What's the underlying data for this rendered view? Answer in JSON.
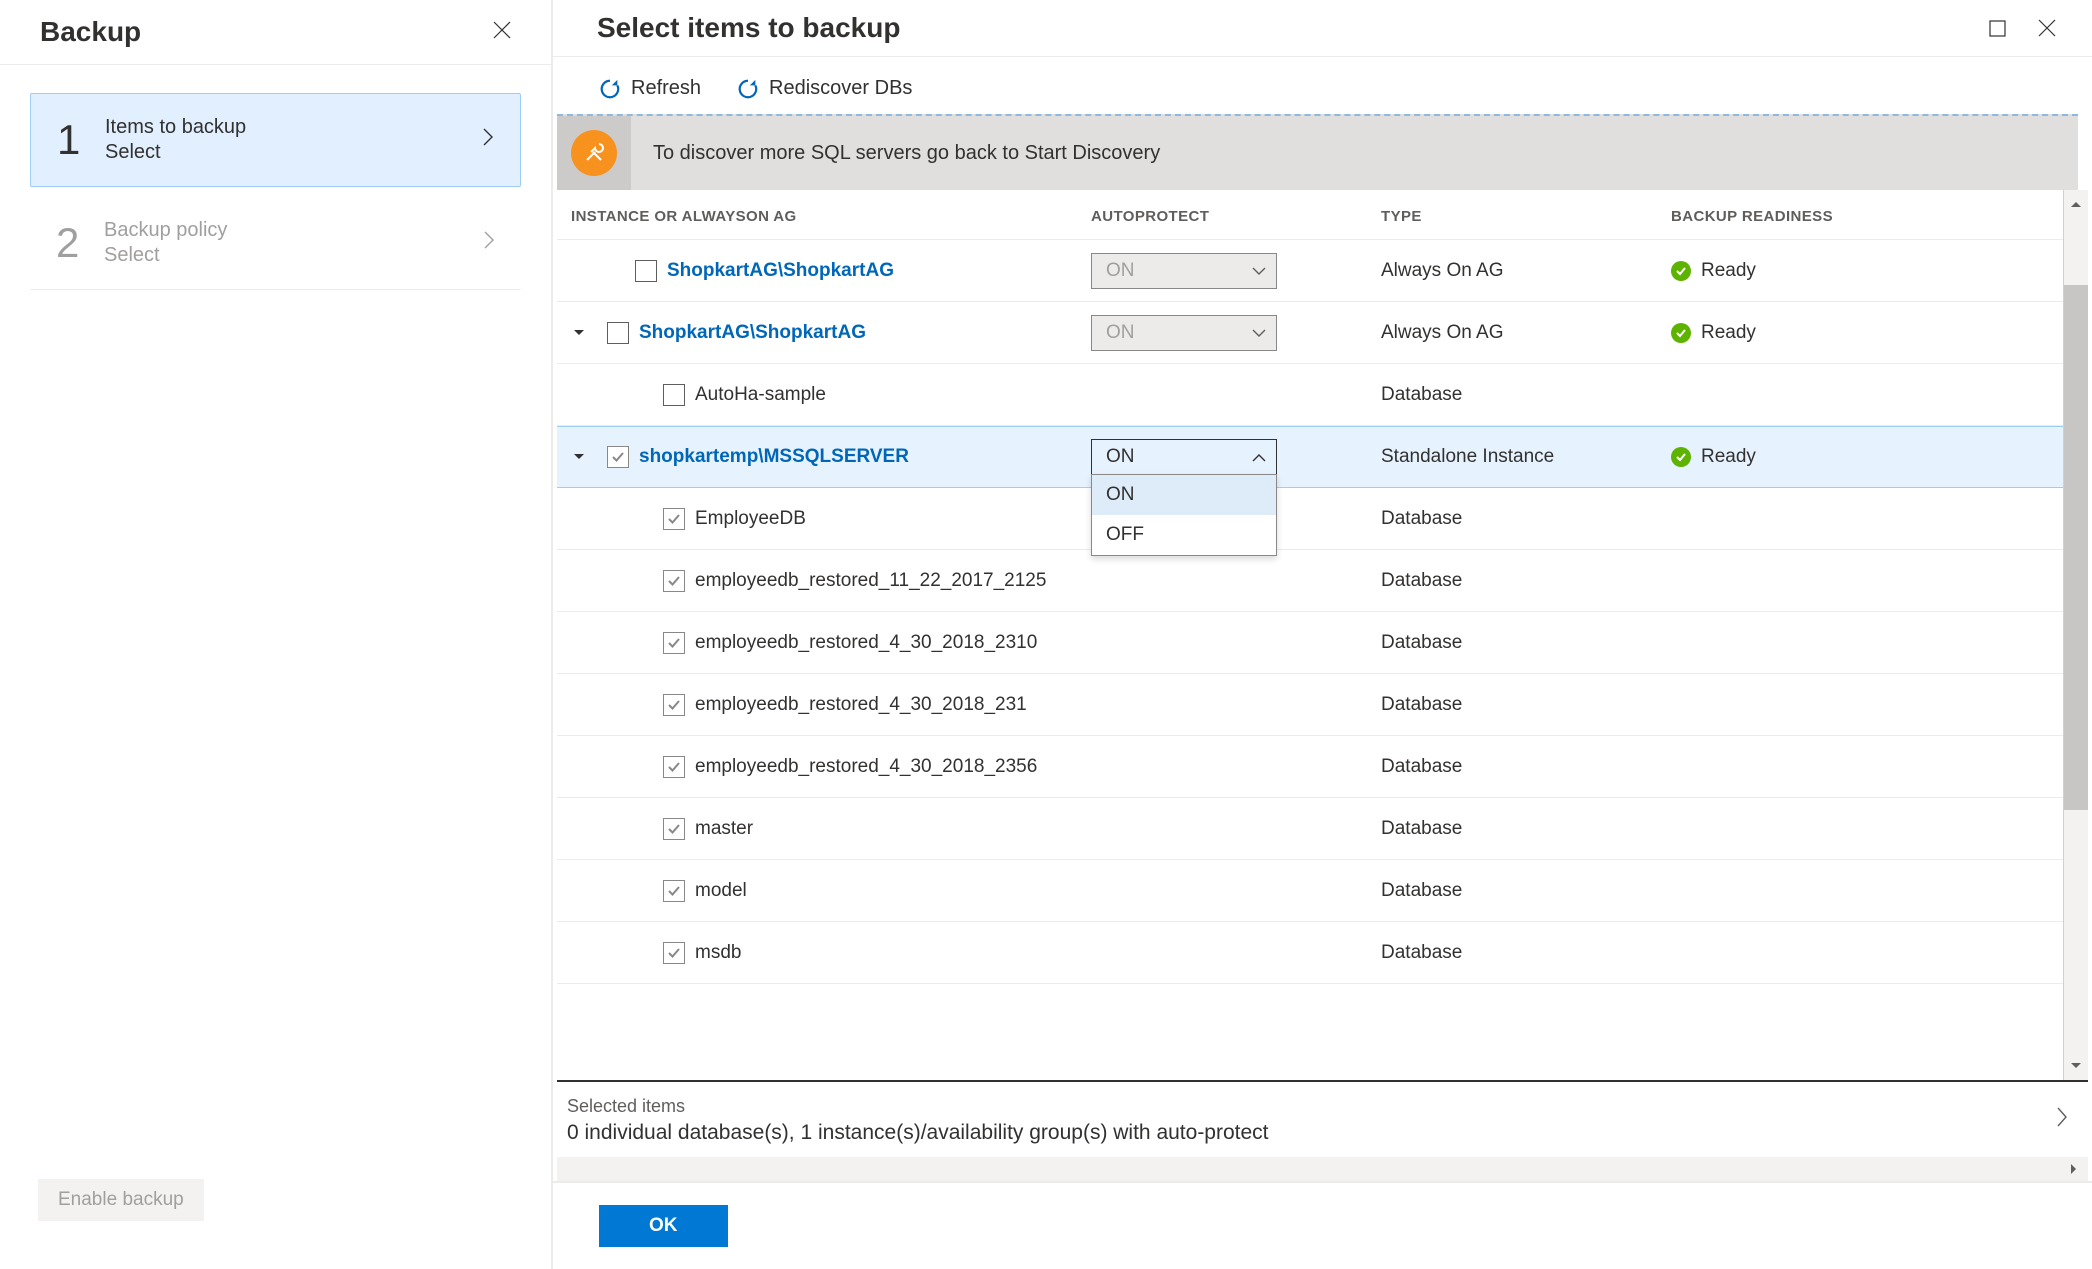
{
  "sidebar": {
    "title": "Backup",
    "steps": [
      {
        "num": "1",
        "label": "Items to backup",
        "sub": "Select"
      },
      {
        "num": "2",
        "label": "Backup policy",
        "sub": "Select"
      }
    ],
    "enable_backup": "Enable backup"
  },
  "main": {
    "title": "Select items to backup",
    "toolbar": {
      "refresh": "Refresh",
      "rediscover": "Rediscover DBs"
    },
    "banner": "To discover more SQL servers go back to Start Discovery",
    "columns": {
      "instance": "INSTANCE OR ALWAYSON AG",
      "autoprotect": "AUTOPROTECT",
      "type": "TYPE",
      "readiness": "BACKUP READINESS"
    },
    "autoprotect_options": {
      "on": "ON",
      "off": "OFF"
    },
    "status_ready": "Ready",
    "rows": [
      {
        "indent": 1,
        "expander": "",
        "checked": false,
        "name": "ShopkartAG\\ShopkartAG",
        "link": true,
        "autoprotect": "ON",
        "autoprotect_state": "disabled",
        "type": "Always On AG",
        "ready": true
      },
      {
        "indent": 0,
        "expander": "down",
        "checked": false,
        "name": "ShopkartAG\\ShopkartAG",
        "link": true,
        "autoprotect": "ON",
        "autoprotect_state": "disabled",
        "type": "Always On AG",
        "ready": true
      },
      {
        "indent": 2,
        "expander": "",
        "checked": false,
        "name": "AutoHa-sample",
        "link": false,
        "autoprotect": "",
        "autoprotect_state": "none",
        "type": "Database",
        "ready": false
      },
      {
        "indent": 0,
        "expander": "down",
        "checked": true,
        "name": "shopkartemp\\MSSQLSERVER",
        "link": true,
        "autoprotect": "ON",
        "autoprotect_state": "open",
        "type": "Standalone Instance",
        "ready": true,
        "selected": true
      },
      {
        "indent": 2,
        "expander": "",
        "checked": true,
        "name": "EmployeeDB",
        "link": false,
        "autoprotect": "",
        "autoprotect_state": "none",
        "type": "Database",
        "ready": false
      },
      {
        "indent": 2,
        "expander": "",
        "checked": true,
        "name": "employeedb_restored_11_22_2017_2125",
        "link": false,
        "autoprotect": "",
        "autoprotect_state": "none",
        "type": "Database",
        "ready": false
      },
      {
        "indent": 2,
        "expander": "",
        "checked": true,
        "name": "employeedb_restored_4_30_2018_2310",
        "link": false,
        "autoprotect": "",
        "autoprotect_state": "none",
        "type": "Database",
        "ready": false
      },
      {
        "indent": 2,
        "expander": "",
        "checked": true,
        "name": "employeedb_restored_4_30_2018_231",
        "link": false,
        "autoprotect": "",
        "autoprotect_state": "none",
        "type": "Database",
        "ready": false
      },
      {
        "indent": 2,
        "expander": "",
        "checked": true,
        "name": "employeedb_restored_4_30_2018_2356",
        "link": false,
        "autoprotect": "",
        "autoprotect_state": "none",
        "type": "Database",
        "ready": false
      },
      {
        "indent": 2,
        "expander": "",
        "checked": true,
        "name": "master",
        "link": false,
        "autoprotect": "",
        "autoprotect_state": "none",
        "type": "Database",
        "ready": false
      },
      {
        "indent": 2,
        "expander": "",
        "checked": true,
        "name": "model",
        "link": false,
        "autoprotect": "",
        "autoprotect_state": "none",
        "type": "Database",
        "ready": false
      },
      {
        "indent": 2,
        "expander": "",
        "checked": true,
        "name": "msdb",
        "link": false,
        "autoprotect": "",
        "autoprotect_state": "none",
        "type": "Database",
        "ready": false
      }
    ],
    "summary": {
      "label": "Selected items",
      "value": "0 individual database(s), 1 instance(s)/availability group(s) with auto-protect"
    },
    "ok": "OK"
  }
}
